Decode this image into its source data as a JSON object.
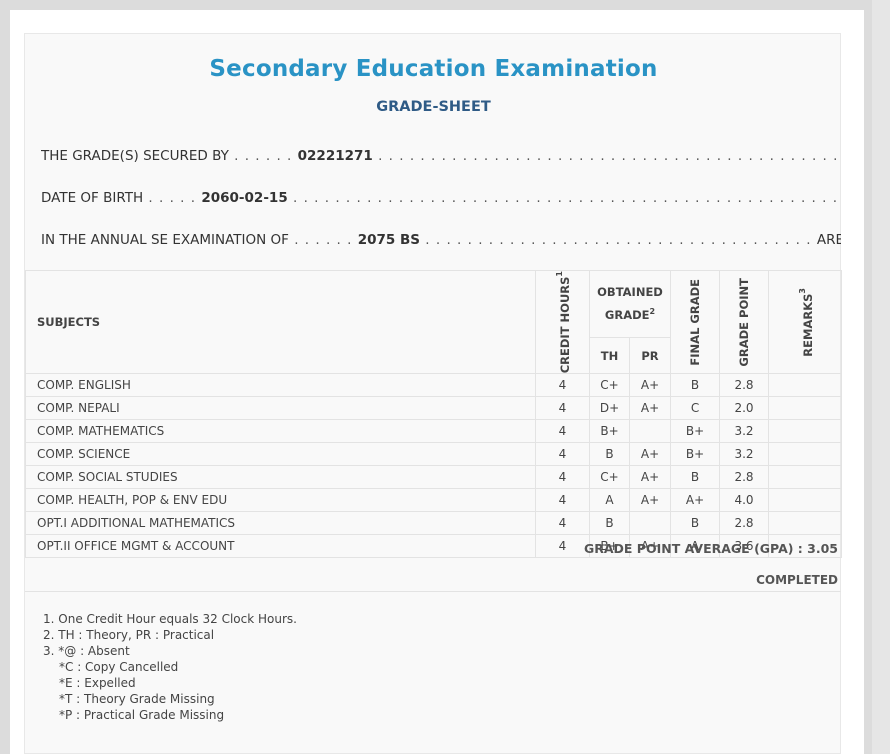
{
  "header": {
    "title": "Secondary Education Examination",
    "subtitle": "GRADE-SHEET"
  },
  "info": {
    "secured_by_label": "THE GRADE(S) SECURED BY",
    "symbol_no": "02221271",
    "dob_label": "DATE OF BIRTH",
    "dob": "2060-02-15",
    "exam_label": "IN THE ANNUAL SE EXAMINATION OF",
    "exam_year": "2075 BS",
    "exam_suffix": "ARE GIVEN BELOW"
  },
  "table": {
    "headers": {
      "subjects": "SUBJECTS",
      "credit_hours": "CREDIT HOURS",
      "credit_note": "1",
      "obtained_grade": "OBTAINED GRADE",
      "obtained_note": "2",
      "th": "TH",
      "pr": "PR",
      "final_grade": "FINAL GRADE",
      "grade_point": "GRADE POINT",
      "remarks": "REMARKS",
      "remarks_note": "3"
    },
    "rows": [
      {
        "subject": "COMP. ENGLISH",
        "credit": "4",
        "th": "C+",
        "pr": "A+",
        "final": "B",
        "gp": "2.8",
        "remarks": ""
      },
      {
        "subject": "COMP. NEPALI",
        "credit": "4",
        "th": "D+",
        "pr": "A+",
        "final": "C",
        "gp": "2.0",
        "remarks": ""
      },
      {
        "subject": "COMP. MATHEMATICS",
        "credit": "4",
        "th": "B+",
        "pr": "",
        "final": "B+",
        "gp": "3.2",
        "remarks": ""
      },
      {
        "subject": "COMP. SCIENCE",
        "credit": "4",
        "th": "B",
        "pr": "A+",
        "final": "B+",
        "gp": "3.2",
        "remarks": ""
      },
      {
        "subject": "COMP. SOCIAL STUDIES",
        "credit": "4",
        "th": "C+",
        "pr": "A+",
        "final": "B",
        "gp": "2.8",
        "remarks": ""
      },
      {
        "subject": "COMP. HEALTH, POP & ENV EDU",
        "credit": "4",
        "th": "A",
        "pr": "A+",
        "final": "A+",
        "gp": "4.0",
        "remarks": ""
      },
      {
        "subject": "OPT.I ADDITIONAL MATHEMATICS",
        "credit": "4",
        "th": "B",
        "pr": "",
        "final": "B",
        "gp": "2.8",
        "remarks": ""
      },
      {
        "subject": "OPT.II OFFICE MGMT & ACCOUNT",
        "credit": "4",
        "th": "B+",
        "pr": "A+",
        "final": "A",
        "gp": "3.6",
        "remarks": ""
      }
    ]
  },
  "summary": {
    "gpa_label": "GRADE POINT AVERAGE (GPA) : 3.05",
    "status": "COMPLETED"
  },
  "notes": [
    "1. One Credit Hour equals 32 Clock Hours.",
    "2. TH : Theory, PR : Practical",
    "3. *@ : Absent",
    "*C : Copy Cancelled",
    "*E : Expelled",
    "*T : Theory Grade Missing",
    "*P : Practical Grade Missing"
  ]
}
